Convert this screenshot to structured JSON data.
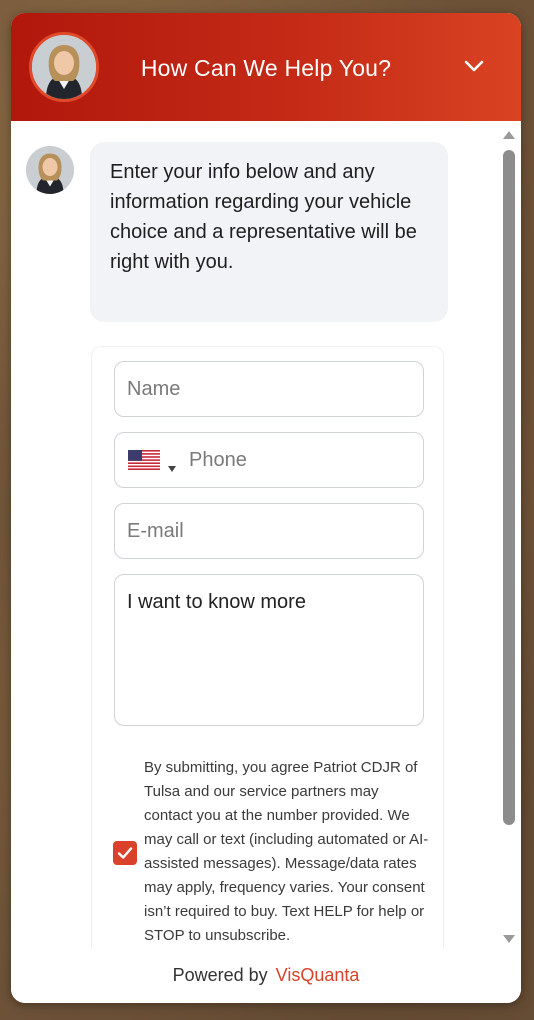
{
  "header": {
    "title": "How Can We Help You?",
    "avatar_icon": "agent-avatar",
    "collapse_icon": "chevron-down-icon"
  },
  "message": {
    "text": "Enter your info below and any information regarding your vehicle choice and a representative will be right with you."
  },
  "form": {
    "name_placeholder": "Name",
    "phone_placeholder": "Phone",
    "phone_country": "US",
    "email_placeholder": "E-mail",
    "message_value": "I want to know more",
    "consent_checked": true,
    "consent_text": "By submitting, you agree Patriot CDJR of Tulsa and our service partners may contact you at the number provided. We may call or text (including automated or AI-assisted messages). Message/data rates may apply, frequency varies. Your consent isn’t required to buy. Text HELP for help or STOP to unsubscribe."
  },
  "footer": {
    "prefix": "Powered by",
    "brand": "VisQuanta"
  },
  "colors": {
    "header_start": "#b1180c",
    "header_end": "#d94322",
    "accent": "#d9412b",
    "bubble_bg": "#f1f3f6"
  }
}
